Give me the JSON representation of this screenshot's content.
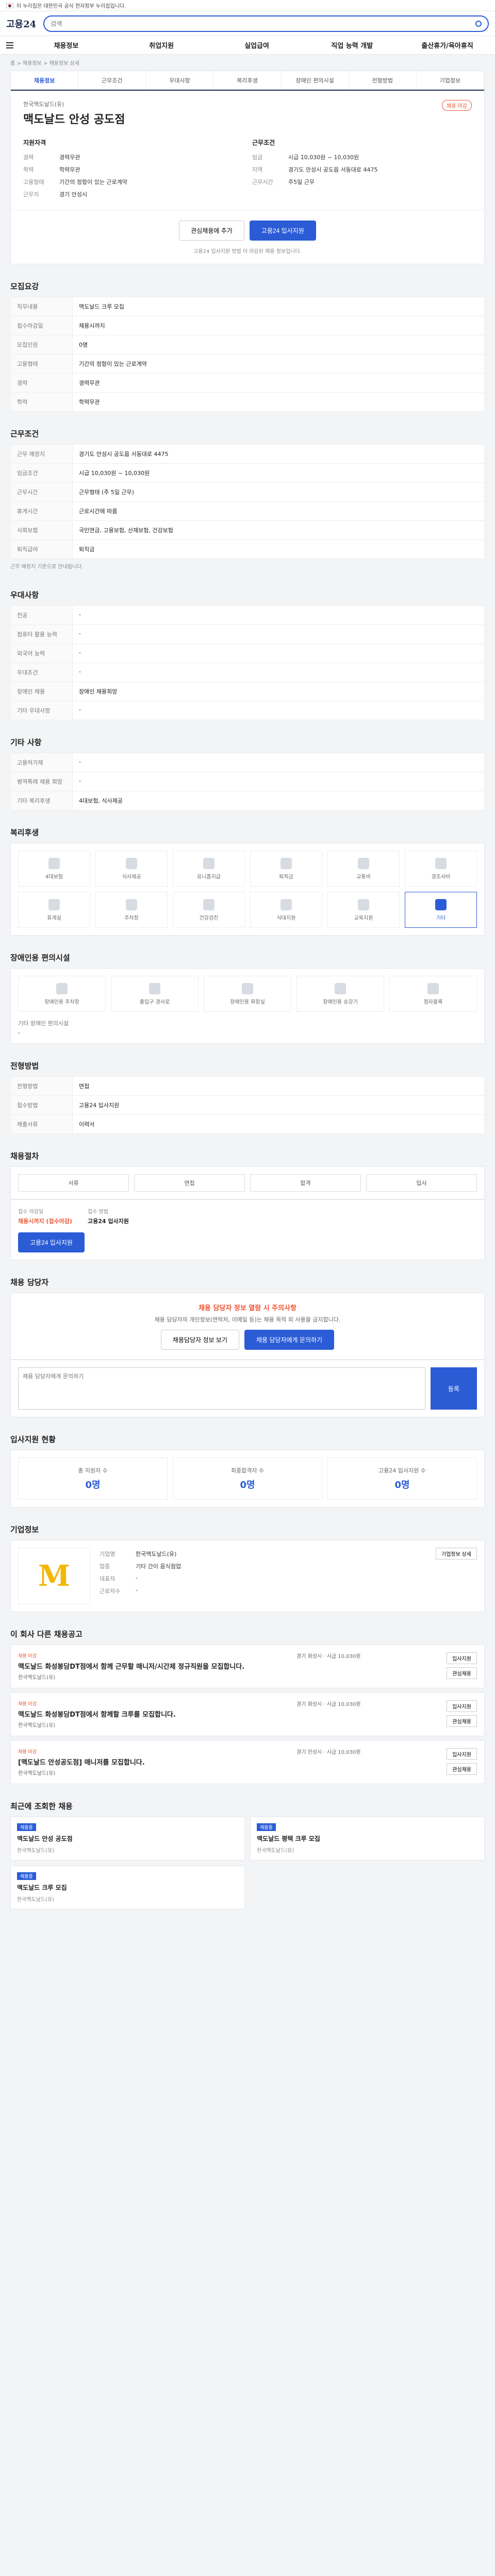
{
  "gov": {
    "text": "이 누리집은 대한민국 공식 전자정부 누리집입니다."
  },
  "top": {
    "logo": "고용24",
    "search_placeholder": "검색"
  },
  "gnb": [
    "채용정보",
    "취업지원",
    "실업급여",
    "직업 능력 개발",
    "출산휴가/육아휴직"
  ],
  "breadcrumb": "홈 > 채용정보 > 채용정보 상세",
  "tabs": [
    "채용정보",
    "근무조건",
    "우대사항",
    "복리후생",
    "장애인 편의시설",
    "전형방법",
    "기업정보"
  ],
  "hero": {
    "company": "한국맥도날드(유)",
    "title": "맥도날드 안성 공도점",
    "badge": "채용 마감",
    "left_title": "지원자격",
    "right_title": "근무조건",
    "left": [
      {
        "k": "경력",
        "v": "경력무관"
      },
      {
        "k": "학력",
        "v": "학력무관"
      },
      {
        "k": "고용형태",
        "v": "기간의 정함이 있는 근로계약"
      },
      {
        "k": "근무지",
        "v": "경기 안성시"
      }
    ],
    "right": [
      {
        "k": "임금",
        "v": "시급 10,030원 ~ 10,030원"
      },
      {
        "k": "지역",
        "v": "경기도 안성시 공도읍 서동대로 4475"
      },
      {
        "k": "근무시간",
        "v": "주5일 근무"
      }
    ],
    "btn_interest": "관심채용에 추가",
    "btn_apply": "고용24 입사지원",
    "note": "고용24 입사지원 방법 이 마감된 채용 정보입니다."
  },
  "s_recruit": {
    "title": "모집요강",
    "rows": [
      {
        "k": "직무내용",
        "v": "맥도날드 크루 모집"
      },
      {
        "k": "접수마감일",
        "v": "채용시까지"
      },
      {
        "k": "모집인원",
        "v": "0명"
      },
      {
        "k": "고용형태",
        "v": "기간의 정함이 있는 근로계약"
      },
      {
        "k": "경력",
        "v": "경력무관"
      },
      {
        "k": "학력",
        "v": "학력무관"
      }
    ]
  },
  "s_cond": {
    "title": "근무조건",
    "rows": [
      {
        "k": "근무 예정지",
        "v": "경기도 안성시 공도읍 서동대로 4475"
      },
      {
        "k": "임금조건",
        "v": "시급 10,030원 ~ 10,030원"
      },
      {
        "k": "근무시간",
        "v": "근무형태 (주 5일 근무)"
      },
      {
        "k": "휴게시간",
        "v": "근로시간에 따름"
      },
      {
        "k": "사회보험",
        "v": "국민연금, 고용보험, 산재보험, 건강보험"
      },
      {
        "k": "퇴직급여",
        "v": "퇴직금"
      }
    ],
    "note": "근무 예정지 기준으로 안내됩니다."
  },
  "s_pref": {
    "title": "우대사항",
    "rows": [
      {
        "k": "전공",
        "v": "-"
      },
      {
        "k": "컴퓨터 활용 능력",
        "v": "-"
      },
      {
        "k": "외국어 능력",
        "v": "-"
      },
      {
        "k": "우대조건",
        "v": "-"
      },
      {
        "k": "장애인 채용",
        "v": "장애인 채용희망"
      },
      {
        "k": "기타 우대사항",
        "v": "-"
      }
    ]
  },
  "s_etc": {
    "title": "기타 사항",
    "rows": [
      {
        "k": "고용허가제",
        "v": "-"
      },
      {
        "k": "병역특례 채용 희망",
        "v": "-"
      },
      {
        "k": "기타 복리후생",
        "v": "4대보험, 식사제공"
      }
    ]
  },
  "s_welfare": {
    "title": "복리후생",
    "items": [
      "4대보험",
      "식사제공",
      "유니폼지급",
      "퇴직금",
      "교통비",
      "경조사비",
      "휴게실",
      "주차장",
      "건강검진",
      "식대지원",
      "교육지원",
      "기타"
    ],
    "active_index": 11
  },
  "s_disab": {
    "title": "장애인용 편의시설",
    "items": [
      "장애인용 주차장",
      "출입구 경사로",
      "장애인용 화장실",
      "장애인용 승강기",
      "점자블록"
    ],
    "bottom_label": "기타 장애인 편의시설",
    "bottom_value": "-"
  },
  "s_select": {
    "title": "전형방법",
    "rows": [
      {
        "k": "전형방법",
        "v": "면접"
      },
      {
        "k": "접수방법",
        "v": "고용24 입사지원"
      },
      {
        "k": "제출서류",
        "v": "이력서"
      }
    ]
  },
  "s_process": {
    "title": "채용절차",
    "steps": [
      "서류",
      "면접",
      "합격",
      "입사"
    ]
  },
  "s_apply": {
    "lbl1": "접수 마감일",
    "val1": "채용시까지 (접수마감)",
    "lbl2": "접수 방법",
    "val2": "고용24 입사지원",
    "btn": "고용24 입사지원"
  },
  "s_contact": {
    "title": "채용 담당자",
    "warn": "채용 담당자 정보 열람 시 주의사항",
    "sub": "채용 담당자의 개인정보(연락처, 이메일 등)는 채용 목적 외 사용을 금지합니다.",
    "btn1": "채용담당자 정보 보기",
    "btn2": "채용 담당자에게 문의하기",
    "qa_placeholder": "채용 담당자에게 문의하기",
    "qa_btn": "등록"
  },
  "s_stats": {
    "title": "입사지원 현황",
    "items": [
      {
        "lbl": "총 지원자 수",
        "num": "0명"
      },
      {
        "lbl": "최종합격자 수",
        "num": "0명"
      },
      {
        "lbl": "고용24 입사지원 수",
        "num": "0명"
      }
    ]
  },
  "s_company": {
    "title": "기업정보",
    "logo_letter": "M",
    "rows": [
      {
        "k": "기업명",
        "v": "한국맥도날드(유)"
      },
      {
        "k": "업종",
        "v": "기타 간이 음식점업"
      },
      {
        "k": "대표자",
        "v": "-"
      },
      {
        "k": "근로자수",
        "v": "-"
      }
    ],
    "btn": "기업정보 상세"
  },
  "s_other": {
    "title": "이 회사 다른 채용공고",
    "jobs": [
      {
        "tag": "채용 마감",
        "title": "맥도날드 화성봉담DT점에서 함께 근무할 매니저/시간제 정규직원을 모집합니다.",
        "co": "한국맥도날드(유)",
        "info": "경기 화성시 · 시급 10,030원"
      },
      {
        "tag": "채용 마감",
        "title": "맥도날드 화성봉담DT점에서 함께할 크루를 모집합니다.",
        "co": "한국맥도날드(유)",
        "info": "경기 화성시 · 시급 10,030원"
      },
      {
        "tag": "채용 마감",
        "title": "[맥도날드 안성공도점] 매니저를 모집합니다.",
        "co": "한국맥도날드(유)",
        "info": "경기 안성시 · 시급 10,030원"
      }
    ],
    "btn_a": "입사지원",
    "btn_b": "관심채용"
  },
  "s_recent": {
    "title": "최근에 조회한 채용",
    "items": [
      {
        "pill": "채용중",
        "t": "맥도날드 안성 공도점",
        "d": "한국맥도날드(유)"
      },
      {
        "pill": "채용중",
        "t": "맥도날드 평택 크루 모집",
        "d": "한국맥도날드(유)"
      },
      {
        "pill": "채용중",
        "t": "맥도날드 크루 모집",
        "d": "한국맥도날드(유)"
      }
    ]
  }
}
